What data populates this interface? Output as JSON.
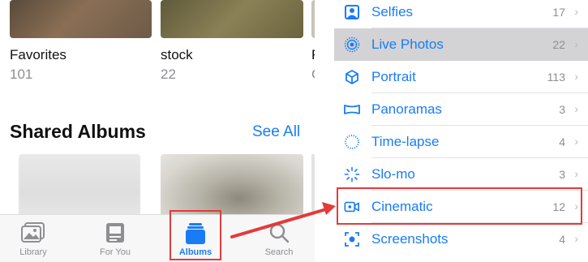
{
  "albums": [
    {
      "name": "Favorites",
      "count": "101"
    },
    {
      "name": "stock",
      "count": "22"
    },
    {
      "name": "F",
      "count": "C"
    }
  ],
  "shared": {
    "title": "Shared Albums",
    "see_all": "See All"
  },
  "tabbar": {
    "tabs": [
      {
        "label": "Library",
        "icon": "library-icon"
      },
      {
        "label": "For You",
        "icon": "for-you-icon"
      },
      {
        "label": "Albums",
        "icon": "albums-icon",
        "active": true
      },
      {
        "label": "Search",
        "icon": "search-icon"
      }
    ]
  },
  "media_types": [
    {
      "label": "Selfies",
      "count": "17",
      "icon": "selfie-icon"
    },
    {
      "label": "Live Photos",
      "count": "22",
      "icon": "live-photo-icon",
      "highlighted": true
    },
    {
      "label": "Portrait",
      "count": "113",
      "icon": "portrait-cube-icon"
    },
    {
      "label": "Panoramas",
      "count": "3",
      "icon": "panorama-icon"
    },
    {
      "label": "Time-lapse",
      "count": "4",
      "icon": "timelapse-icon"
    },
    {
      "label": "Slo-mo",
      "count": "3",
      "icon": "slomo-icon"
    },
    {
      "label": "Cinematic",
      "count": "12",
      "icon": "cinematic-icon",
      "annotated": true
    },
    {
      "label": "Screenshots",
      "count": "4",
      "icon": "screenshot-icon"
    }
  ],
  "colors": {
    "accent": "#1a7cf5",
    "annotation": "#e23b3b",
    "highlight_row": "#d3d3d6"
  }
}
